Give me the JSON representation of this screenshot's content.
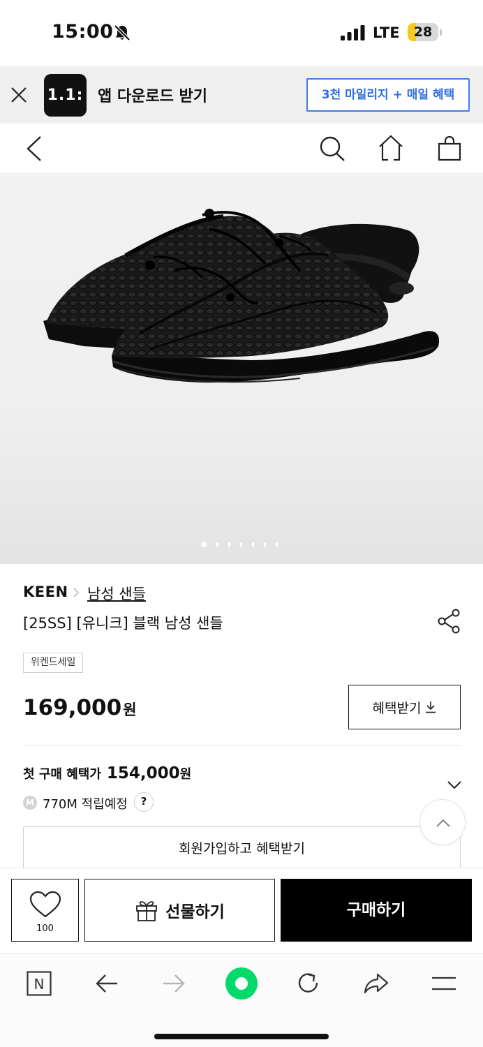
{
  "status_bar": {
    "time": "15:00",
    "network": "LTE",
    "battery": "28",
    "battery_level": 0.28
  },
  "app_banner": {
    "logo_text": "1.1:",
    "title": "앱 다운로드 받기",
    "cta": "3천 마일리지 + 매일 혜택"
  },
  "product": {
    "brand": "KEEN",
    "category": "남성 샌들",
    "name": "[25SS] [유니크] 블랙 남성 샌들",
    "tag": "위켄드세일",
    "price": "169,000",
    "price_unit": "원",
    "benefit_button": "혜택받기",
    "first_purchase_label": "첫 구매 혜택가",
    "first_purchase_price": "154,000",
    "first_purchase_unit": "원",
    "mileage_badge": "M",
    "mileage": "770M 적립예정",
    "help": "?",
    "signup_button": "회원가입하고 혜택받기",
    "image_count": 7,
    "image_index": 1
  },
  "purchase_bar": {
    "like_count": "100",
    "gift_label": "선물하기",
    "buy_label": "구매하기"
  },
  "browser_bar": {
    "n_label": "N"
  },
  "colors": {
    "accent_blue": "#2f6fdf",
    "naver_green": "#03d96b"
  }
}
